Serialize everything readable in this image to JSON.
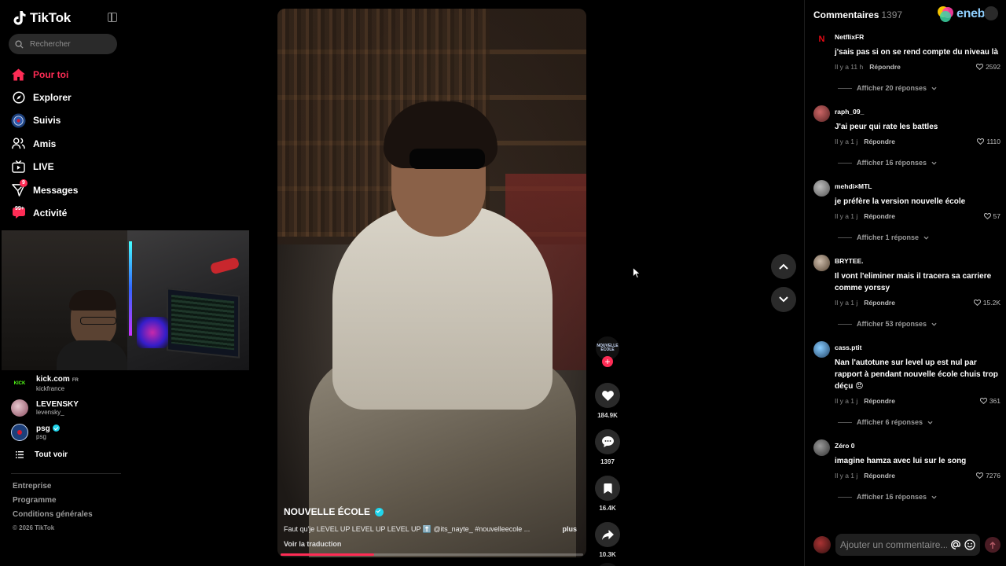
{
  "app": {
    "name": "TikTok"
  },
  "search": {
    "placeholder": "Rechercher"
  },
  "nav": [
    {
      "label": "Pour toi",
      "icon": "home-icon",
      "active": true
    },
    {
      "label": "Explorer",
      "icon": "compass-icon"
    },
    {
      "label": "Suivis",
      "icon": "following-avatar-icon"
    },
    {
      "label": "Amis",
      "icon": "friends-icon"
    },
    {
      "label": "LIVE",
      "icon": "live-icon"
    },
    {
      "label": "Messages",
      "icon": "messages-icon",
      "badge": "9"
    },
    {
      "label": "Activité",
      "icon": "activity-icon",
      "badge": "99+"
    }
  ],
  "following": [
    {
      "name": "kick.com",
      "tag": "FR",
      "handle": "kickfrance",
      "avatar_text": "KICK"
    },
    {
      "name": "LEVENSKY",
      "handle": "levensky_"
    },
    {
      "name": "psg",
      "handle": "psg",
      "verified": true
    }
  ],
  "see_all": "Tout voir",
  "footer": {
    "links": [
      "Entreprise",
      "Programme",
      "Conditions générales"
    ],
    "copyright": "© 2026 TikTok"
  },
  "video": {
    "author": "NOUVELLE ÉCOLE",
    "verified": true,
    "description": "Faut qu'je LEVEL UP LEVEL UP LEVEL UP ⬆️ @its_nayte_ #nouvelleecole ...",
    "more": "plus",
    "translate": "Voir la traduction",
    "progress": 0.31
  },
  "actions": {
    "avatar_text": "NOUVELLE ÉCOLE",
    "follow": "+",
    "likes": "184.9K",
    "comments": "1397",
    "saves": "16.4K",
    "shares": "10.3K"
  },
  "comments_panel": {
    "title": "Commentaires",
    "count": "1397",
    "ad_brand": "eneba",
    "input_placeholder": "Ajouter un commentaire...",
    "items": [
      {
        "user": "NetflixFR",
        "avatar_text": "N",
        "avatar_color": "#e50914",
        "text": "j'sais pas si on se rend compte du niveau là",
        "time": "Il y a 11 h",
        "reply": "Répondre",
        "likes": "2592",
        "replies": "Afficher 20 réponses"
      },
      {
        "user": "raph_09_",
        "text": "J'ai peur qui rate les battles",
        "time": "Il y a 1 j",
        "reply": "Répondre",
        "likes": "1110",
        "replies": "Afficher 16 réponses"
      },
      {
        "user": "mehdi×MTL",
        "text": "je préfère la version nouvelle école",
        "time": "Il y a 1 j",
        "reply": "Répondre",
        "likes": "57",
        "replies": "Afficher 1 réponse"
      },
      {
        "user": "BRYTEE.",
        "text": "Il vont l'eliminer mais il tracera sa carriere comme yorssy",
        "time": "Il y a 1 j",
        "reply": "Répondre",
        "likes": "15.2K",
        "replies": "Afficher 53 réponses"
      },
      {
        "user": "cass.ptit",
        "text": "Nan l'autotune sur level up est nul par rapport à pendant nouvelle école chuis trop déçu 😠",
        "time": "Il y a 1 j",
        "reply": "Répondre",
        "likes": "361",
        "replies": "Afficher 6 réponses"
      },
      {
        "user": "Zéro 0",
        "text": "imagine hamza avec lui sur le song",
        "time": "Il y a 1 j",
        "reply": "Répondre",
        "likes": "7276",
        "replies": "Afficher 16 réponses"
      }
    ]
  },
  "colors": {
    "accent": "#fe2c55",
    "verified": "#20d5ec",
    "background": "#000000"
  }
}
